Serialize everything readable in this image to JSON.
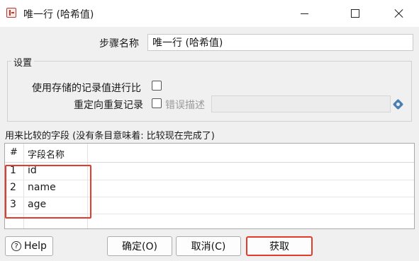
{
  "window": {
    "title": "唯一行 (哈希值)",
    "controls": {
      "minimize": "minimize",
      "maximize": "maximize",
      "close": "close"
    }
  },
  "step": {
    "label": "步骤名称",
    "value": "唯一行 (哈希值)"
  },
  "settings": {
    "group_title": "设置",
    "use_stored_label": "使用存储的记录值进行比",
    "use_stored_checked": false,
    "redirect_label": "重定向重复记录",
    "redirect_checked": false,
    "error_desc_label": "错误描述",
    "error_desc_value": ""
  },
  "fields_caption": "用来比较的字段 (没有条目意味着: 比较现在完成了)",
  "table": {
    "columns": [
      "#",
      "字段名称"
    ],
    "rows": [
      {
        "num": "1",
        "name": "id"
      },
      {
        "num": "2",
        "name": "name"
      },
      {
        "num": "3",
        "name": "age"
      }
    ]
  },
  "buttons": {
    "help": "Help",
    "ok": "确定(O)",
    "cancel": "取消(C)",
    "get": "获取"
  },
  "colors": {
    "highlight": "#e53b2c",
    "background": "#f0f0f0"
  }
}
